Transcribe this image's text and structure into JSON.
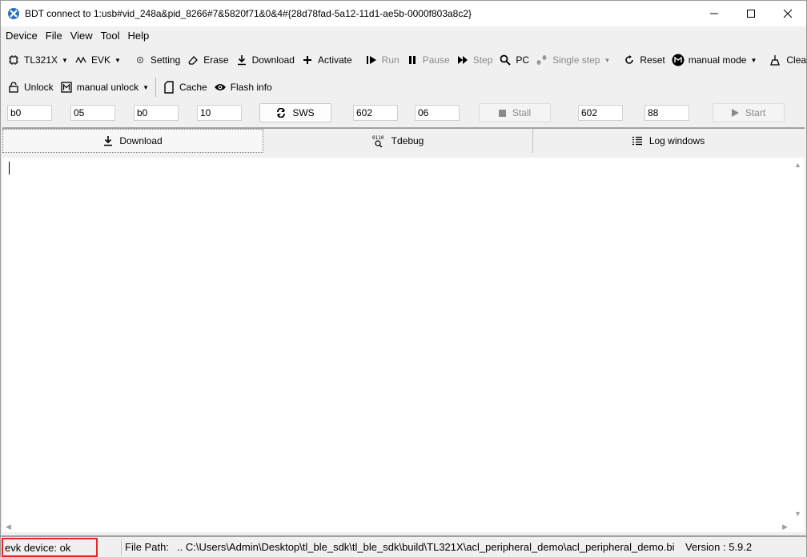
{
  "window": {
    "title": "BDT connect to 1:usb#vid_248a&pid_8266#7&5820f71&0&4#{28d78fad-5a12-11d1-ae5b-0000f803a8c2}"
  },
  "menu": [
    "Device",
    "File",
    "View",
    "Tool",
    "Help"
  ],
  "toolbar1": {
    "chip": "TL321X",
    "board": "EVK",
    "setting": "Setting",
    "erase": "Erase",
    "download": "Download",
    "activate": "Activate",
    "run": "Run",
    "pause": "Pause",
    "step": "Step",
    "pc": "PC",
    "single_step": "Single step",
    "reset": "Reset",
    "manual_mode": "manual mode",
    "clear": "Clear"
  },
  "toolbar2": {
    "unlock": "Unlock",
    "manual_unlock": "manual unlock",
    "cache": "Cache",
    "flash_info": "Flash info"
  },
  "registers": {
    "field1": "b0",
    "field2": "05",
    "field3": "b0",
    "field4": "10",
    "sws_label": "SWS",
    "field5": "602",
    "field6": "06",
    "stall_label": "Stall",
    "field7": "602",
    "field8": "88",
    "start_label": "Start"
  },
  "tabs": {
    "download": "Download",
    "tdebug": "Tdebug",
    "log_windows": "Log windows"
  },
  "status": {
    "device": "evk device: ok",
    "file_path_label": "File Path:",
    "file_path": "..  C:\\Users\\Admin\\Desktop\\tl_ble_sdk\\tl_ble_sdk\\build\\TL321X\\acl_peripheral_demo\\acl_peripheral_demo.bi",
    "version": "Version : 5.9.2"
  },
  "colors": {
    "accent_red": "#e82525",
    "app_icon_blue": "#2f6fc0"
  }
}
